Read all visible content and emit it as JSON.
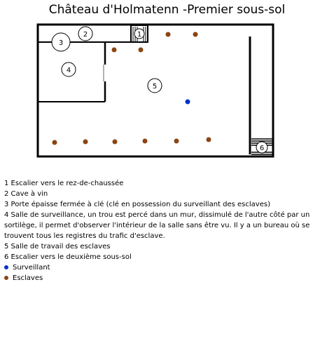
{
  "title": "Château d'Holmatenn -Premier sous-sol",
  "colors": {
    "wall": "#000000",
    "surveillant": "#0033cc",
    "esclave": "#8b4513"
  },
  "rooms": {
    "r1": "1",
    "r2": "2",
    "r3": "3",
    "r4": "4",
    "r5": "5",
    "r6": "6"
  },
  "legend": {
    "l1": "1  Escalier vers le rez-de-chaussée",
    "l2": "2  Cave à vin",
    "l3": "3  Porte épaisse fermée à clé (clé en possession du surveillant des esclaves)",
    "l4": "4  Salle de surveillance, un trou est percé dans un mur, dissimulé de l'autre côté par un sortilège, il permet d'observer l'intérieur de la salle sans être vu. Il y a un bureau où se trouvent tous les registres du trafic d'esclave.",
    "l5": "5  Salle de travail des esclaves",
    "l6": "6  Escalier vers le deuxième sous-sol",
    "surveillant": "Surveillant",
    "esclaves": "Esclaves"
  }
}
